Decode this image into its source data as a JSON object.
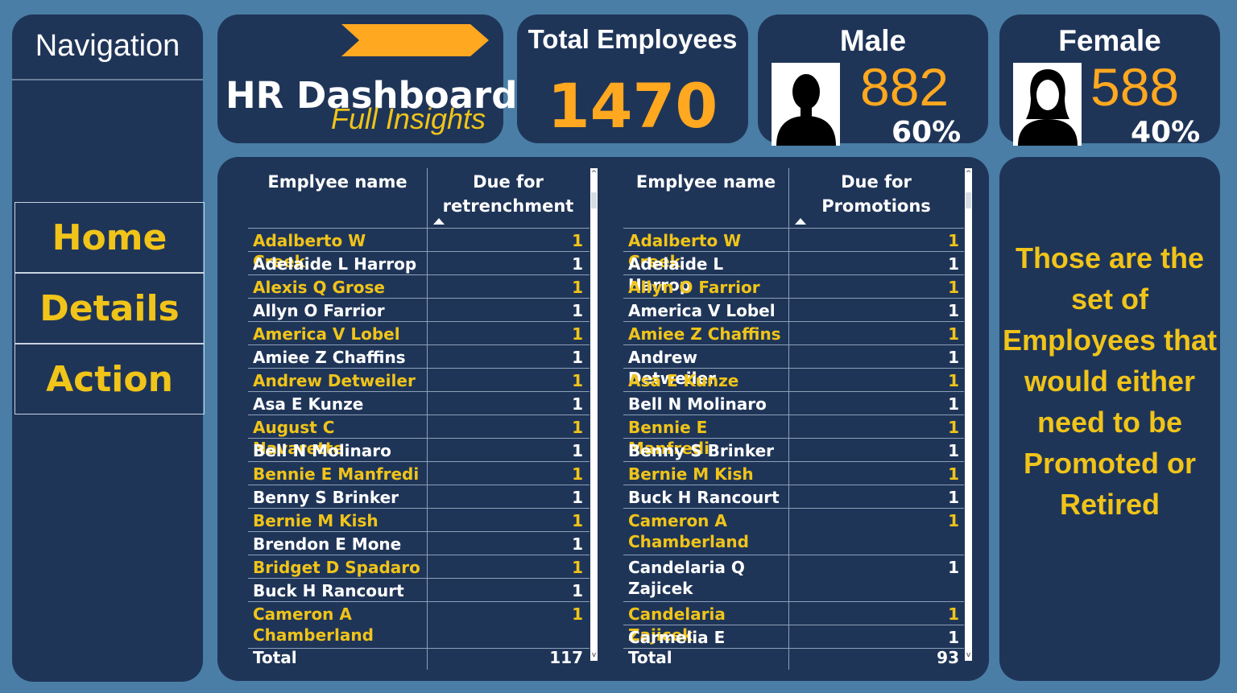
{
  "navigation": {
    "title": "Navigation",
    "buttons": [
      {
        "label": "Home"
      },
      {
        "label": "Details"
      },
      {
        "label": "Action"
      }
    ]
  },
  "header": {
    "title": "HR Dashboard",
    "subtitle": "Full Insights",
    "arrow_color": "#ffa820"
  },
  "kpis": {
    "total": {
      "label": "Total Employees",
      "value": "1470"
    },
    "male": {
      "label": "Male",
      "count": "882",
      "percent": "60%",
      "icon": "male-person-icon"
    },
    "female": {
      "label": "Female",
      "count": "588",
      "percent": "40%",
      "icon": "female-person-icon"
    }
  },
  "colors": {
    "background": "#4a7ea6",
    "panel": "#1f3558",
    "accent_orange": "#ffa820",
    "accent_yellow": "#f0c419",
    "row_highlight": "#f0c419",
    "row_plain": "#ffffff"
  },
  "tables": {
    "retrenchment": {
      "columns": [
        "Emplyee name",
        "Due for retrenchment"
      ],
      "sorted_column": 1,
      "rows": [
        {
          "name": "Adalberto W Creek",
          "value": "1"
        },
        {
          "name": "Adelaide L Harrop",
          "value": "1"
        },
        {
          "name": "Alexis Q Grose",
          "value": "1"
        },
        {
          "name": "Allyn O Farrior",
          "value": "1"
        },
        {
          "name": "America V Lobel",
          "value": "1"
        },
        {
          "name": "Amiee Z Chaffins",
          "value": "1"
        },
        {
          "name": "Andrew Detweiler",
          "value": "1"
        },
        {
          "name": "Asa E Kunze",
          "value": "1"
        },
        {
          "name": "August C Navarette",
          "value": "1"
        },
        {
          "name": "Bell N Molinaro",
          "value": "1"
        },
        {
          "name": "Bennie E Manfredi",
          "value": "1"
        },
        {
          "name": "Benny S Brinker",
          "value": "1"
        },
        {
          "name": "Bernie M Kish",
          "value": "1"
        },
        {
          "name": "Brendon E Mone",
          "value": "1"
        },
        {
          "name": "Bridget D Spadaro",
          "value": "1"
        },
        {
          "name": "Buck H Rancourt",
          "value": "1"
        },
        {
          "name": "Cameron A Chamberland",
          "value": "1"
        }
      ],
      "total_label": "Total",
      "total_value": "117"
    },
    "promotions": {
      "columns": [
        "Emplyee name",
        "Due for Promotions"
      ],
      "sorted_column": 1,
      "rows": [
        {
          "name": "Adalberto W Creek",
          "value": "1"
        },
        {
          "name": "Adelaide L Harrop",
          "value": "1"
        },
        {
          "name": "Allyn O Farrior",
          "value": "1"
        },
        {
          "name": "America V Lobel",
          "value": "1"
        },
        {
          "name": "Amiee Z Chaffins",
          "value": "1"
        },
        {
          "name": "Andrew Detweiler",
          "value": "1"
        },
        {
          "name": "Asa E Kunze",
          "value": "1"
        },
        {
          "name": "Bell N Molinaro",
          "value": "1"
        },
        {
          "name": "Bennie E Manfredi",
          "value": "1"
        },
        {
          "name": "Benny S Brinker",
          "value": "1"
        },
        {
          "name": "Bernie M Kish",
          "value": "1"
        },
        {
          "name": "Buck H Rancourt",
          "value": "1"
        },
        {
          "name": "Cameron A Chamberland",
          "value": "1"
        },
        {
          "name": "Candelaria Q Zajicek",
          "value": "1"
        },
        {
          "name": "Candelaria Zajicek",
          "value": "1"
        },
        {
          "name": "Carmelia E",
          "value": "1"
        }
      ],
      "total_label": "Total",
      "total_value": "93"
    }
  },
  "note": {
    "text": "Those are the set of Employees that would either need to be Promoted or Retired"
  }
}
